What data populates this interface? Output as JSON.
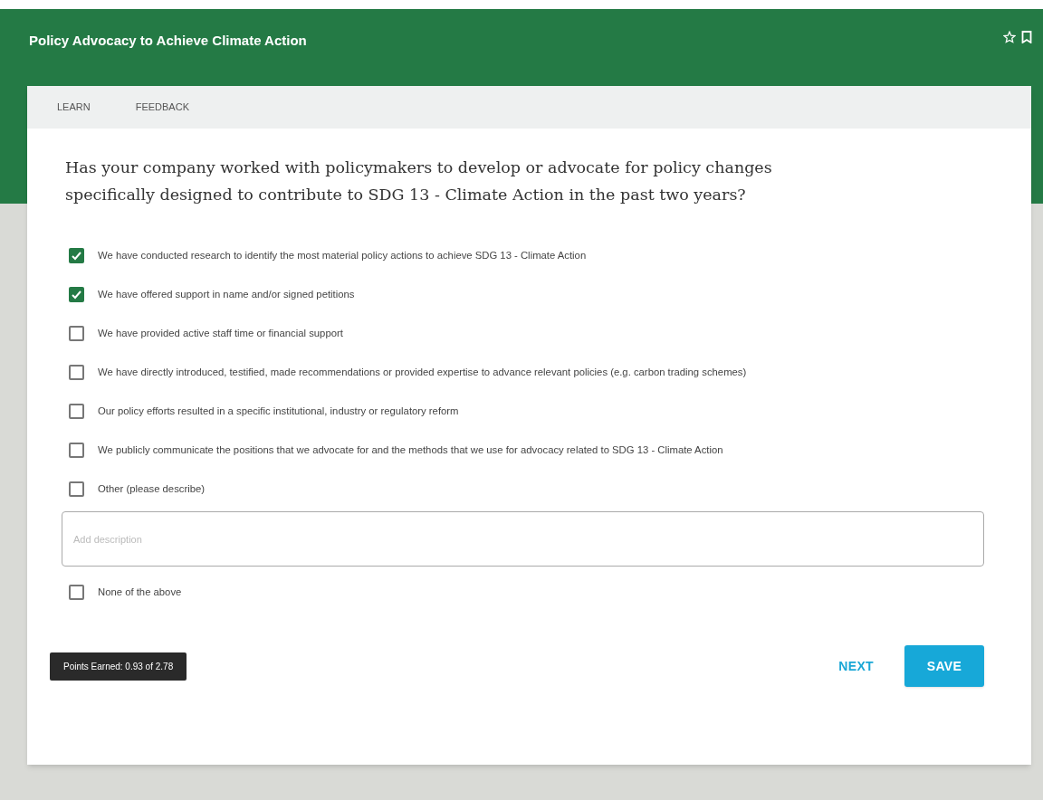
{
  "header": {
    "title": "Policy Advocacy to Achieve Climate Action"
  },
  "tabs": [
    {
      "label": "LEARN"
    },
    {
      "label": "FEEDBACK"
    }
  ],
  "question": "Has your company worked with policymakers to develop or advocate for policy changes specifically designed to contribute to SDG 13 - Climate Action in the past two years?",
  "options": [
    {
      "label": "We have conducted research to identify the most material policy actions to achieve SDG 13 - Climate Action",
      "checked": true
    },
    {
      "label": "We have offered support in name and/or signed petitions",
      "checked": true
    },
    {
      "label": "We have provided active staff time or financial support",
      "checked": false
    },
    {
      "label": "We have directly introduced, testified, made recommendations or provided expertise to advance relevant policies (e.g. carbon trading schemes)",
      "checked": false
    },
    {
      "label": "Our policy efforts resulted in a specific institutional, industry or regulatory reform",
      "checked": false
    },
    {
      "label": "We publicly communicate the positions that we advocate for and the methods that we use for advocacy related to SDG 13 - Climate Action",
      "checked": false
    },
    {
      "label": "Other (please describe)",
      "checked": false
    }
  ],
  "description_field": {
    "placeholder": "Add description"
  },
  "last_option": {
    "label": "None of the above",
    "checked": false
  },
  "points": "Points Earned:  0.93 of 2.78",
  "buttons": {
    "next": "NEXT",
    "save": "SAVE"
  }
}
